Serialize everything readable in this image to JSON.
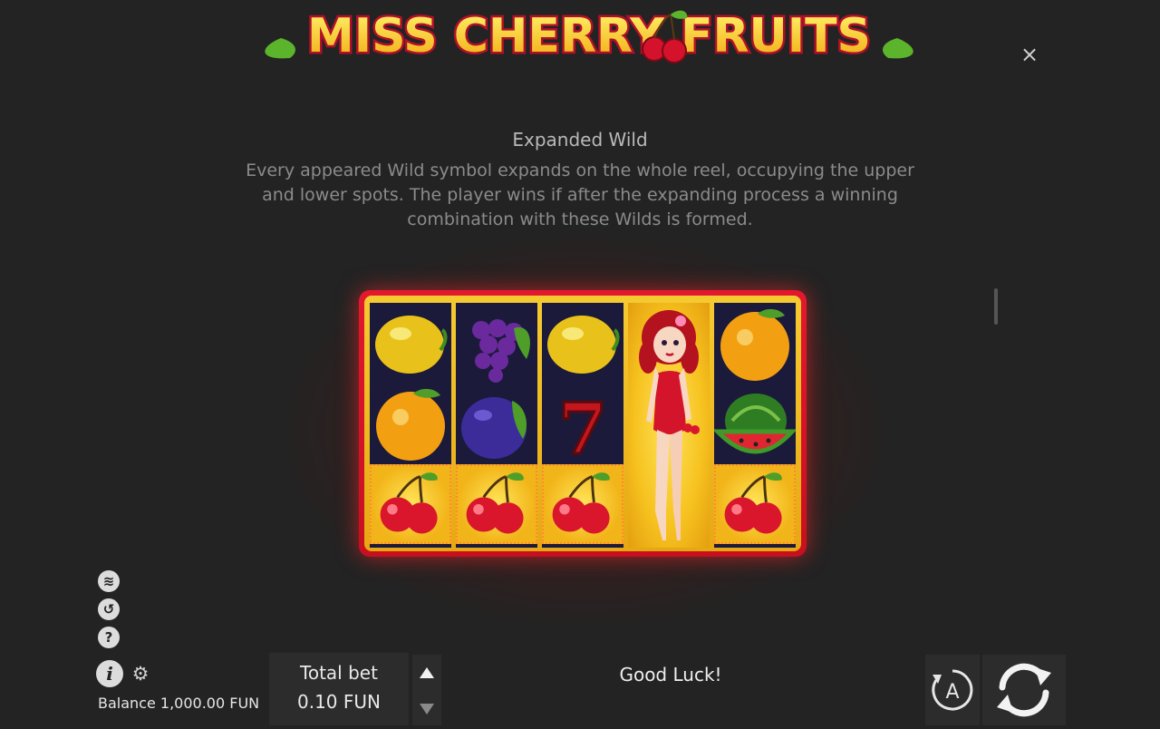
{
  "game": {
    "logo_text": "MISS CHERRY FRUITS"
  },
  "close_label": "×",
  "rules": {
    "section_title": "Expanded Wild",
    "section_text": "Every appeared Wild symbol expands on the whole reel, occupying the upper and lower spots. The player wins if after the expanding process a winning combination with these Wilds is formed."
  },
  "reels": {
    "columns": [
      [
        "lemon",
        "orange",
        "cherry"
      ],
      [
        "grapes",
        "plum",
        "cherry"
      ],
      [
        "lemon",
        "seven",
        "cherry"
      ],
      [
        "wild",
        "wild",
        "wild"
      ],
      [
        "orange",
        "watermelon",
        "cherry"
      ]
    ],
    "seven_label": "7"
  },
  "side_icons": {
    "turbo": "≋",
    "history": "↺",
    "help": "?",
    "info": "i",
    "settings": "⚙"
  },
  "footer": {
    "balance": "Balance 1,000.00 FUN",
    "total_bet_label": "Total bet",
    "total_bet_value": "0.10 FUN",
    "message": "Good Luck!",
    "autoplay_label": "A"
  },
  "colors": {
    "background": "#232323",
    "frame": "#e3182f",
    "gold": "#f5cb31",
    "reel_bg": "#1c1a3a"
  }
}
